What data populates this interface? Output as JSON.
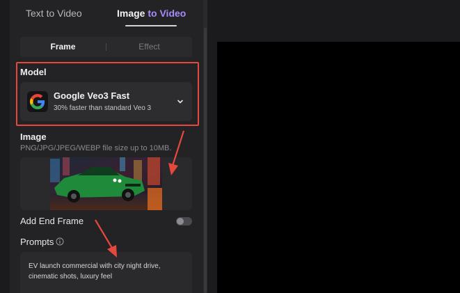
{
  "tabs": {
    "text_to_video": "Text to Video",
    "image_to_video_prefix": "Image ",
    "image_to_video_highlight": "to Video"
  },
  "segmented": {
    "frame": "Frame",
    "effect": "Effect"
  },
  "model": {
    "label": "Model",
    "name": "Google Veo3 Fast",
    "description": "30% faster than standard Veo 3",
    "icon": "google-g-icon"
  },
  "image": {
    "label": "Image",
    "hint": "PNG/JPG/JPEG/WEBP file size up to 10MB."
  },
  "end_frame": {
    "label": "Add End Frame",
    "enabled": false
  },
  "prompts": {
    "label": "Prompts",
    "value": "EV launch commercial with city night drive, cinematic shots, luxury feel"
  },
  "colors": {
    "accent": "#a78bfa",
    "highlight_box": "#e5483d",
    "panel": "#232325",
    "preview": "#000000"
  }
}
